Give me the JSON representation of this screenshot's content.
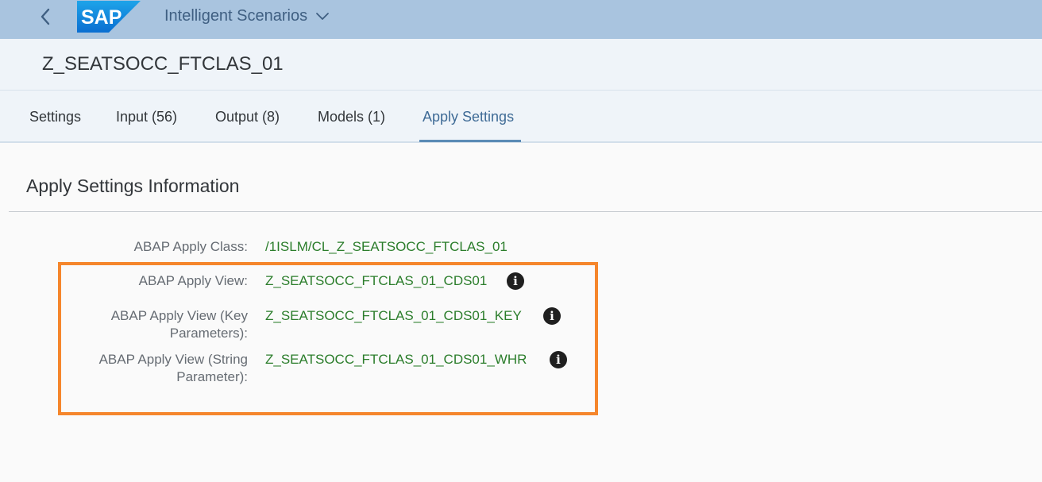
{
  "shellbar": {
    "logo_text": "SAP",
    "app_title": "Intelligent Scenarios"
  },
  "header": {
    "object_title": "Z_SEATSOCC_FTCLAS_01"
  },
  "tabs": [
    {
      "label": "Settings",
      "selected": false
    },
    {
      "label": "Input (56)",
      "selected": false
    },
    {
      "label": "Output (8)",
      "selected": false
    },
    {
      "label": "Models (1)",
      "selected": false
    },
    {
      "label": "Apply Settings",
      "selected": true
    }
  ],
  "section": {
    "title": "Apply Settings Information"
  },
  "fields": {
    "apply_class": {
      "label": "ABAP Apply Class:",
      "value": "/1ISLM/CL_Z_SEATSOCC_FTCLAS_01"
    },
    "apply_view": {
      "label": "ABAP Apply View:",
      "value": "Z_SEATSOCC_FTCLAS_01_CDS01"
    },
    "apply_view_key": {
      "label_line1": "ABAP Apply View (Key",
      "label_line2": "Parameters):",
      "value": "Z_SEATSOCC_FTCLAS_01_CDS01_KEY"
    },
    "apply_view_string": {
      "label_line1": "ABAP Apply View (String",
      "label_line2": "Parameter):",
      "value": "Z_SEATSOCC_FTCLAS_01_CDS01_WHR"
    }
  },
  "info_icon_glyph": "i",
  "colors": {
    "shellbar_bg": "#a9c4df",
    "value_green": "#2b7d2b",
    "highlight_orange": "#f5862c",
    "selected_tab": "#3f6b96"
  }
}
